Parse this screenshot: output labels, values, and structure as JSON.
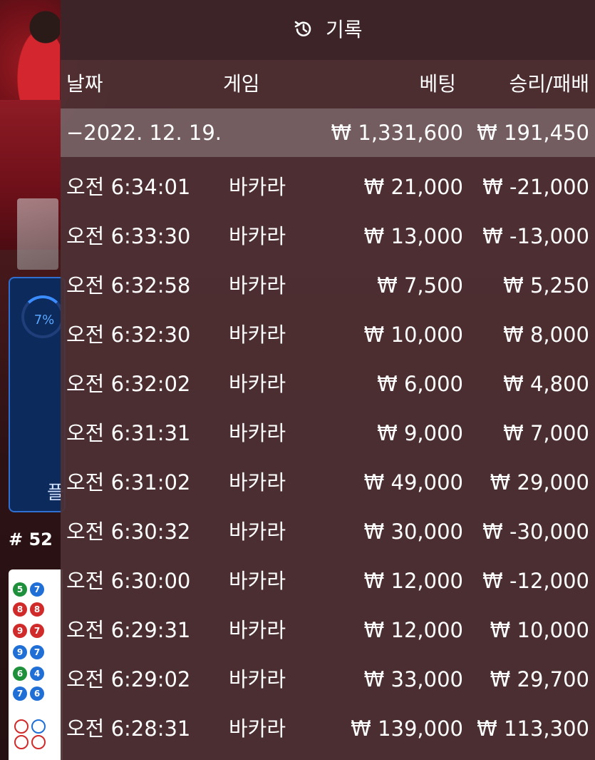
{
  "background": {
    "timer_percent": "7%",
    "timer_label": "플",
    "round_number": "# 52",
    "road_cells": [
      "5",
      "7",
      "8",
      "8",
      "9",
      "7",
      "9",
      "7",
      "6",
      "4",
      "7",
      "6"
    ]
  },
  "history": {
    "title": "기록",
    "icon": "history-icon",
    "columns": {
      "date": "날짜",
      "game": "게임",
      "bet": "베팅",
      "result": "승리/패배"
    },
    "date_group": {
      "date": "−2022. 12. 19.",
      "total_bet": "₩ 1,331,600",
      "total_result": "₩ 191,450"
    },
    "rows": [
      {
        "time": "오전 6:34:01",
        "game": "바카라",
        "bet": "₩ 21,000",
        "result": "₩ -21,000"
      },
      {
        "time": "오전 6:33:30",
        "game": "바카라",
        "bet": "₩ 13,000",
        "result": "₩ -13,000"
      },
      {
        "time": "오전 6:32:58",
        "game": "바카라",
        "bet": "₩ 7,500",
        "result": "₩ 5,250"
      },
      {
        "time": "오전 6:32:30",
        "game": "바카라",
        "bet": "₩ 10,000",
        "result": "₩ 8,000"
      },
      {
        "time": "오전 6:32:02",
        "game": "바카라",
        "bet": "₩ 6,000",
        "result": "₩ 4,800"
      },
      {
        "time": "오전 6:31:31",
        "game": "바카라",
        "bet": "₩ 9,000",
        "result": "₩ 7,000"
      },
      {
        "time": "오전 6:31:02",
        "game": "바카라",
        "bet": "₩ 49,000",
        "result": "₩ 29,000"
      },
      {
        "time": "오전 6:30:32",
        "game": "바카라",
        "bet": "₩ 30,000",
        "result": "₩ -30,000"
      },
      {
        "time": "오전 6:30:00",
        "game": "바카라",
        "bet": "₩ 12,000",
        "result": "₩ -12,000"
      },
      {
        "time": "오전 6:29:31",
        "game": "바카라",
        "bet": "₩ 12,000",
        "result": "₩ 10,000"
      },
      {
        "time": "오전 6:29:02",
        "game": "바카라",
        "bet": "₩ 33,000",
        "result": "₩ 29,700"
      },
      {
        "time": "오전 6:28:31",
        "game": "바카라",
        "bet": "₩ 139,000",
        "result": "₩ 113,300"
      }
    ]
  },
  "colors": {
    "panel_bg": "#4e3034",
    "date_row_bg": "#826e72",
    "text": "#ffffff",
    "timer_accent": "#3b8cff"
  }
}
